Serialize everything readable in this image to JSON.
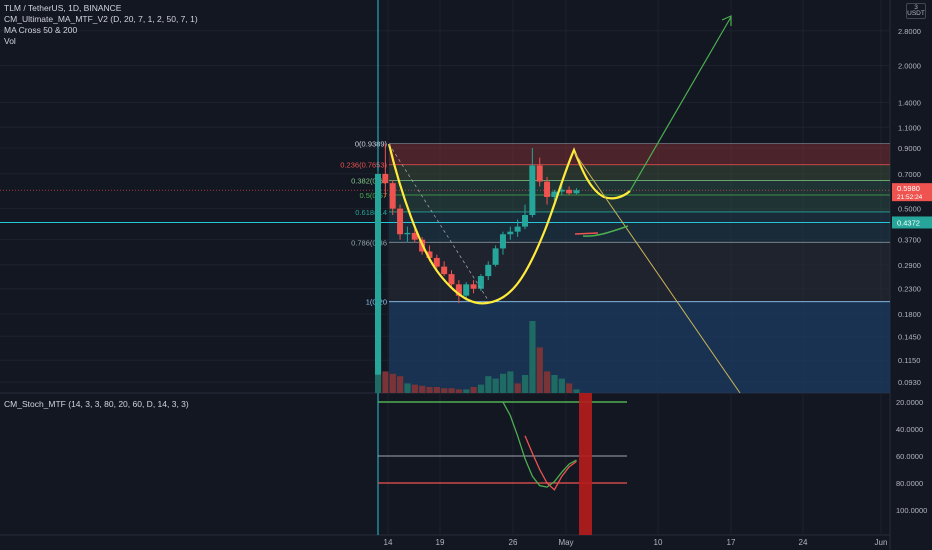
{
  "legend": {
    "symbol_line": "TLM / TetherUS, 1D, BINANCE",
    "indicators": [
      "CM_Ultimate_MA_MTF_V2 (D, 20, 7, 1, 2, 50, 7, 1)",
      "MA Cross 50 & 200",
      "Vol"
    ]
  },
  "stoch_legend": "CM_Stoch_MTF (14, 3, 3, 80, 20, 60, D, 14, 3, 3)",
  "currency_badge": "USDT",
  "colors": {
    "up": "#26a69a",
    "down": "#ef5350",
    "pattern": "#ffeb3b",
    "arrow": "#4caf50",
    "fib_text": "#d1d4dc",
    "target_line": "#26c6da"
  },
  "chart_data": [
    {
      "type": "candlestick",
      "scale": "log",
      "price_ticks": [
        "2.8000",
        "2.0000",
        "1.4000",
        "1.1000",
        "0.9000",
        "0.7000",
        "0.5000",
        "0.3700",
        "0.2900",
        "0.2300",
        "0.1800",
        "0.1450",
        "0.1150",
        "0.0930"
      ],
      "x_ticks": [
        "14",
        "19",
        "26",
        "May",
        "10",
        "17",
        "24",
        "Jun"
      ],
      "last_price": "0.5980",
      "countdown": "21:52:24",
      "marked_level": "0.4372",
      "fib_levels": [
        {
          "label": "0(0.9389)",
          "value": 0.9389
        },
        {
          "label": "0.236(0.7653)",
          "value": 0.7653
        },
        {
          "label": "0.382(0.65",
          "value": 0.6576
        },
        {
          "label": "0.5(0.57",
          "value": 0.5708
        },
        {
          "label": "0.618(0.4",
          "value": 0.4841
        },
        {
          "label": "0.786(0.36",
          "value": 0.3609
        },
        {
          "label": "1(0.20",
          "value": 0.2028
        }
      ],
      "candles": [
        {
          "o": 0.1,
          "h": 0.72,
          "l": 0.1,
          "c": 0.7
        },
        {
          "o": 0.7,
          "h": 0.939,
          "l": 0.56,
          "c": 0.64
        },
        {
          "o": 0.64,
          "h": 0.66,
          "l": 0.47,
          "c": 0.5
        },
        {
          "o": 0.5,
          "h": 0.52,
          "l": 0.37,
          "c": 0.39
        },
        {
          "o": 0.39,
          "h": 0.42,
          "l": 0.36,
          "c": 0.395
        },
        {
          "o": 0.395,
          "h": 0.41,
          "l": 0.36,
          "c": 0.37
        },
        {
          "o": 0.37,
          "h": 0.38,
          "l": 0.32,
          "c": 0.33
        },
        {
          "o": 0.33,
          "h": 0.35,
          "l": 0.3,
          "c": 0.31
        },
        {
          "o": 0.31,
          "h": 0.32,
          "l": 0.28,
          "c": 0.285
        },
        {
          "o": 0.285,
          "h": 0.3,
          "l": 0.26,
          "c": 0.265
        },
        {
          "o": 0.265,
          "h": 0.275,
          "l": 0.235,
          "c": 0.24
        },
        {
          "o": 0.24,
          "h": 0.25,
          "l": 0.2,
          "c": 0.215
        },
        {
          "o": 0.215,
          "h": 0.245,
          "l": 0.205,
          "c": 0.24
        },
        {
          "o": 0.24,
          "h": 0.25,
          "l": 0.22,
          "c": 0.23
        },
        {
          "o": 0.23,
          "h": 0.265,
          "l": 0.225,
          "c": 0.26
        },
        {
          "o": 0.26,
          "h": 0.3,
          "l": 0.25,
          "c": 0.29
        },
        {
          "o": 0.29,
          "h": 0.35,
          "l": 0.285,
          "c": 0.34
        },
        {
          "o": 0.34,
          "h": 0.4,
          "l": 0.32,
          "c": 0.39
        },
        {
          "o": 0.39,
          "h": 0.42,
          "l": 0.37,
          "c": 0.4
        },
        {
          "o": 0.4,
          "h": 0.45,
          "l": 0.38,
          "c": 0.42
        },
        {
          "o": 0.42,
          "h": 0.52,
          "l": 0.41,
          "c": 0.47
        },
        {
          "o": 0.47,
          "h": 0.9,
          "l": 0.46,
          "c": 0.76
        },
        {
          "o": 0.76,
          "h": 0.82,
          "l": 0.62,
          "c": 0.65
        },
        {
          "o": 0.65,
          "h": 0.68,
          "l": 0.52,
          "c": 0.56
        },
        {
          "o": 0.56,
          "h": 0.6,
          "l": 0.54,
          "c": 0.59
        },
        {
          "o": 0.59,
          "h": 0.64,
          "l": 0.57,
          "c": 0.6
        },
        {
          "o": 0.6,
          "h": 0.62,
          "l": 0.57,
          "c": 0.58
        },
        {
          "o": 0.58,
          "h": 0.61,
          "l": 0.575,
          "c": 0.598
        }
      ],
      "volumes": [
        100,
        18,
        16,
        14,
        8,
        7,
        6,
        5,
        5,
        4,
        4,
        3,
        3,
        5,
        7,
        14,
        12,
        16,
        18,
        8,
        15,
        60,
        38,
        18,
        15,
        12,
        8,
        3
      ],
      "volume_up": [
        true,
        false,
        false,
        false,
        true,
        false,
        false,
        false,
        false,
        false,
        false,
        false,
        true,
        false,
        true,
        true,
        true,
        true,
        true,
        false,
        true,
        true,
        false,
        false,
        true,
        true,
        false,
        true
      ]
    },
    {
      "type": "line",
      "name": "CM_Stoch_MTF",
      "y_ticks": [
        "100.0000",
        "80.0000",
        "60.0000",
        "40.0000",
        "20.0000"
      ],
      "ylim": [
        10,
        100
      ],
      "levels": [
        80,
        60,
        20
      ],
      "k": [
        20,
        20,
        20,
        20,
        20,
        20,
        20,
        20,
        20,
        20,
        20,
        20,
        20,
        20,
        20,
        20,
        20,
        20,
        30,
        45,
        62,
        75,
        82,
        83,
        79,
        72,
        66,
        63
      ],
      "d": [
        20,
        20,
        20,
        20,
        20,
        20,
        20,
        20,
        20,
        20,
        20,
        20,
        20,
        20,
        20,
        20,
        20,
        20,
        20,
        20,
        45,
        58,
        70,
        80,
        85,
        75,
        68,
        64
      ]
    }
  ]
}
